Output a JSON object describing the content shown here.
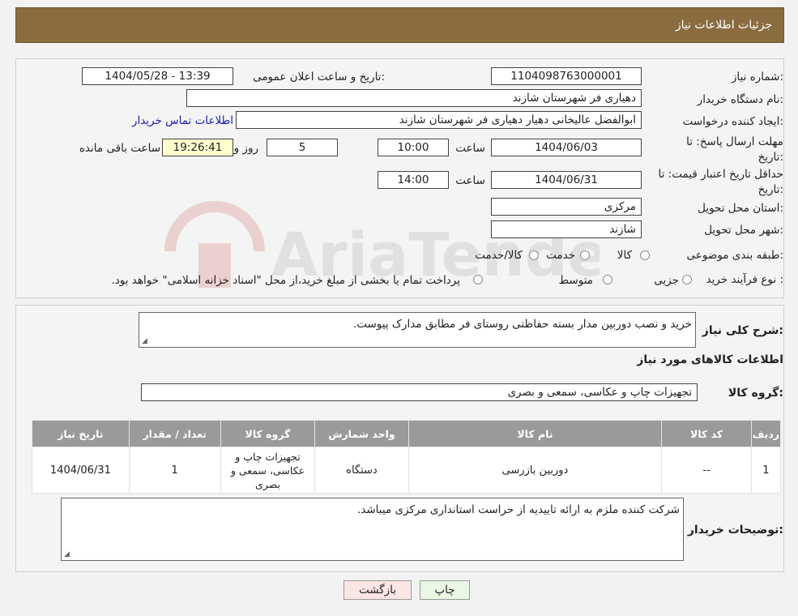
{
  "header": {
    "title": "جزئیات اطلاعات نیاز"
  },
  "form": {
    "need_number_label": "شماره نیاز:",
    "need_number": "1104098763000001",
    "announce_label": "تاریخ و ساعت اعلان عمومی:",
    "announce_value": "1404/05/28 - 13:39",
    "buyer_org_label": "نام دستگاه خریدار:",
    "buyer_org": "دهیاری فر شهرستان شازند",
    "creator_label": "ایجاد کننده درخواست:",
    "creator": "ابوالفضل عالیخانی دهیار دهیاری فر شهرستان شازند",
    "contact_link": "اطلاعات تماس خریدار",
    "deadline_label": "مهلت ارسال پاسخ: تا تاریخ:",
    "deadline_date": "1404/06/03",
    "time_label": "ساعت",
    "deadline_time": "10:00",
    "remaining_days": "5",
    "days_and": "روز و",
    "remaining_time": "19:26:41",
    "remaining_label": "ساعت باقی مانده",
    "validity_label": "حداقل تاریخ اعتبار قیمت: تا تاریخ:",
    "validity_date": "1404/06/31",
    "validity_time": "14:00",
    "province_label": "استان محل تحویل:",
    "province": "مرکزی",
    "city_label": "شهر محل تحویل:",
    "city": "شازند",
    "category_label": "طبقه بندی موضوعی:",
    "category_options": [
      "کالا",
      "خدمت",
      "کالا/خدمت"
    ],
    "process_label": "نوع فرآیند خرید :",
    "process_options": [
      "جزیی",
      "متوسط"
    ],
    "process_note": "پرداخت تمام یا بخشی از مبلغ خرید،از محل \"اسناد خزانه اسلامی\" خواهد بود."
  },
  "details": {
    "description_label": "شرح کلی نیاز:",
    "description": "خرید و نصب دوربین مدار بسته  حفاظتی روستای فر مطابق مدارک پیوست.",
    "goods_info_title": "اطلاعات کالاهای مورد نیاز",
    "goods_group_label": "گروه کالا:",
    "goods_group": "تجهیزات چاپ و عکاسی، سمعی و بصری",
    "table": {
      "headers": [
        "ردیف",
        "کد کالا",
        "نام کالا",
        "واحد شمارش",
        "گروه کالا",
        "تعداد / مقدار",
        "تاریخ نیاز"
      ],
      "rows": [
        [
          "1",
          "--",
          "دوربین بازرسی",
          "دستگاه",
          "تجهیزات چاپ و عکاسی، سمعی و بصری",
          "1",
          "1404/06/31"
        ]
      ]
    },
    "buyer_notes_label": "توضیحات خریدار:",
    "buyer_notes": "شرکت کننده ملزم به ارائه تاییدیه از حراست استانداری مرکزی میباشد."
  },
  "buttons": {
    "print": "چاپ",
    "back": "بازگشت"
  },
  "watermark_text": "AriaTender.neT",
  "colors": {
    "header": "#8b6c40",
    "table_header": "#9a9a9a",
    "remaining_bg": "#fefecf",
    "print_bg": "#eaf7e4",
    "back_bg": "#fbe6e6"
  }
}
